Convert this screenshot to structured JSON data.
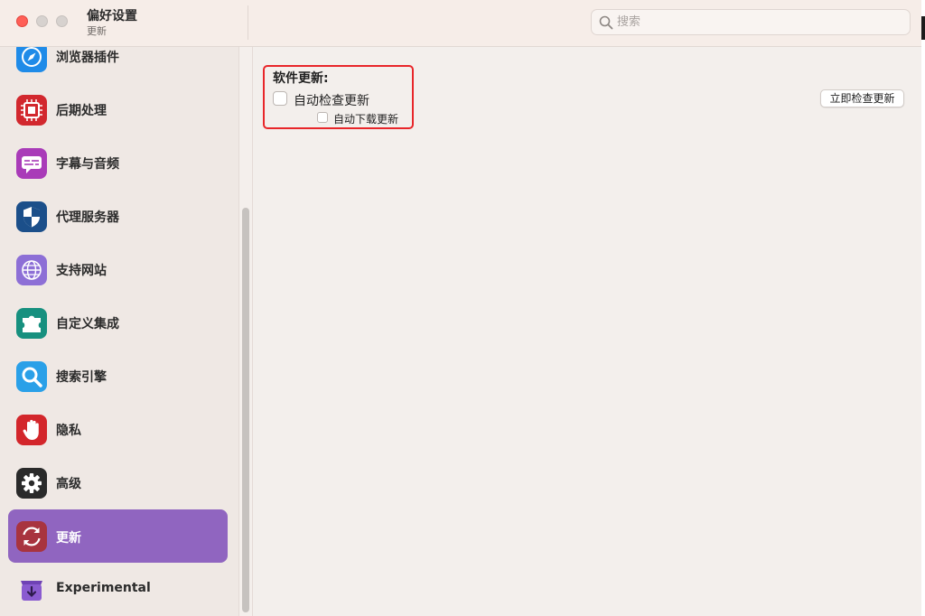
{
  "window": {
    "title": "偏好设置",
    "subtitle": "更新"
  },
  "search": {
    "placeholder": "搜索",
    "value": ""
  },
  "sidebar": {
    "items": [
      {
        "label": "浏览器插件",
        "icon": "compass-icon",
        "color": "#1f8be8"
      },
      {
        "label": "后期处理",
        "icon": "chip-icon",
        "color": "#d2282e"
      },
      {
        "label": "字幕与音频",
        "icon": "subtitles-icon",
        "color": "#a93bb8"
      },
      {
        "label": "代理服务器",
        "icon": "shield-icon",
        "color": "#1b4f8a"
      },
      {
        "label": "支持网站",
        "icon": "globe-icon",
        "color": "#8d6fd6"
      },
      {
        "label": "自定义集成",
        "icon": "puzzle-icon",
        "color": "#17907f"
      },
      {
        "label": "搜索引擎",
        "icon": "magnifier-icon",
        "color": "#2aa0e8"
      },
      {
        "label": "隐私",
        "icon": "hand-icon",
        "color": "#d3262b"
      },
      {
        "label": "高级",
        "icon": "gear-icon",
        "color": "#2a2a2a"
      },
      {
        "label": "更新",
        "icon": "refresh-icon",
        "color": "#a8343f",
        "selected": true
      },
      {
        "label": "Experimental",
        "icon": "download-box-icon",
        "color": "#8a5bd0"
      }
    ]
  },
  "content": {
    "section_title": "软件更新:",
    "auto_check_label": "自动检查更新",
    "auto_download_label": "自动下载更新",
    "check_now_label": "立即检查更新",
    "auto_check_checked": false,
    "auto_download_checked": false
  },
  "colors": {
    "selected_bg": "#9065c0",
    "highlight_border": "#e8262a",
    "close": "#ff5f57"
  }
}
